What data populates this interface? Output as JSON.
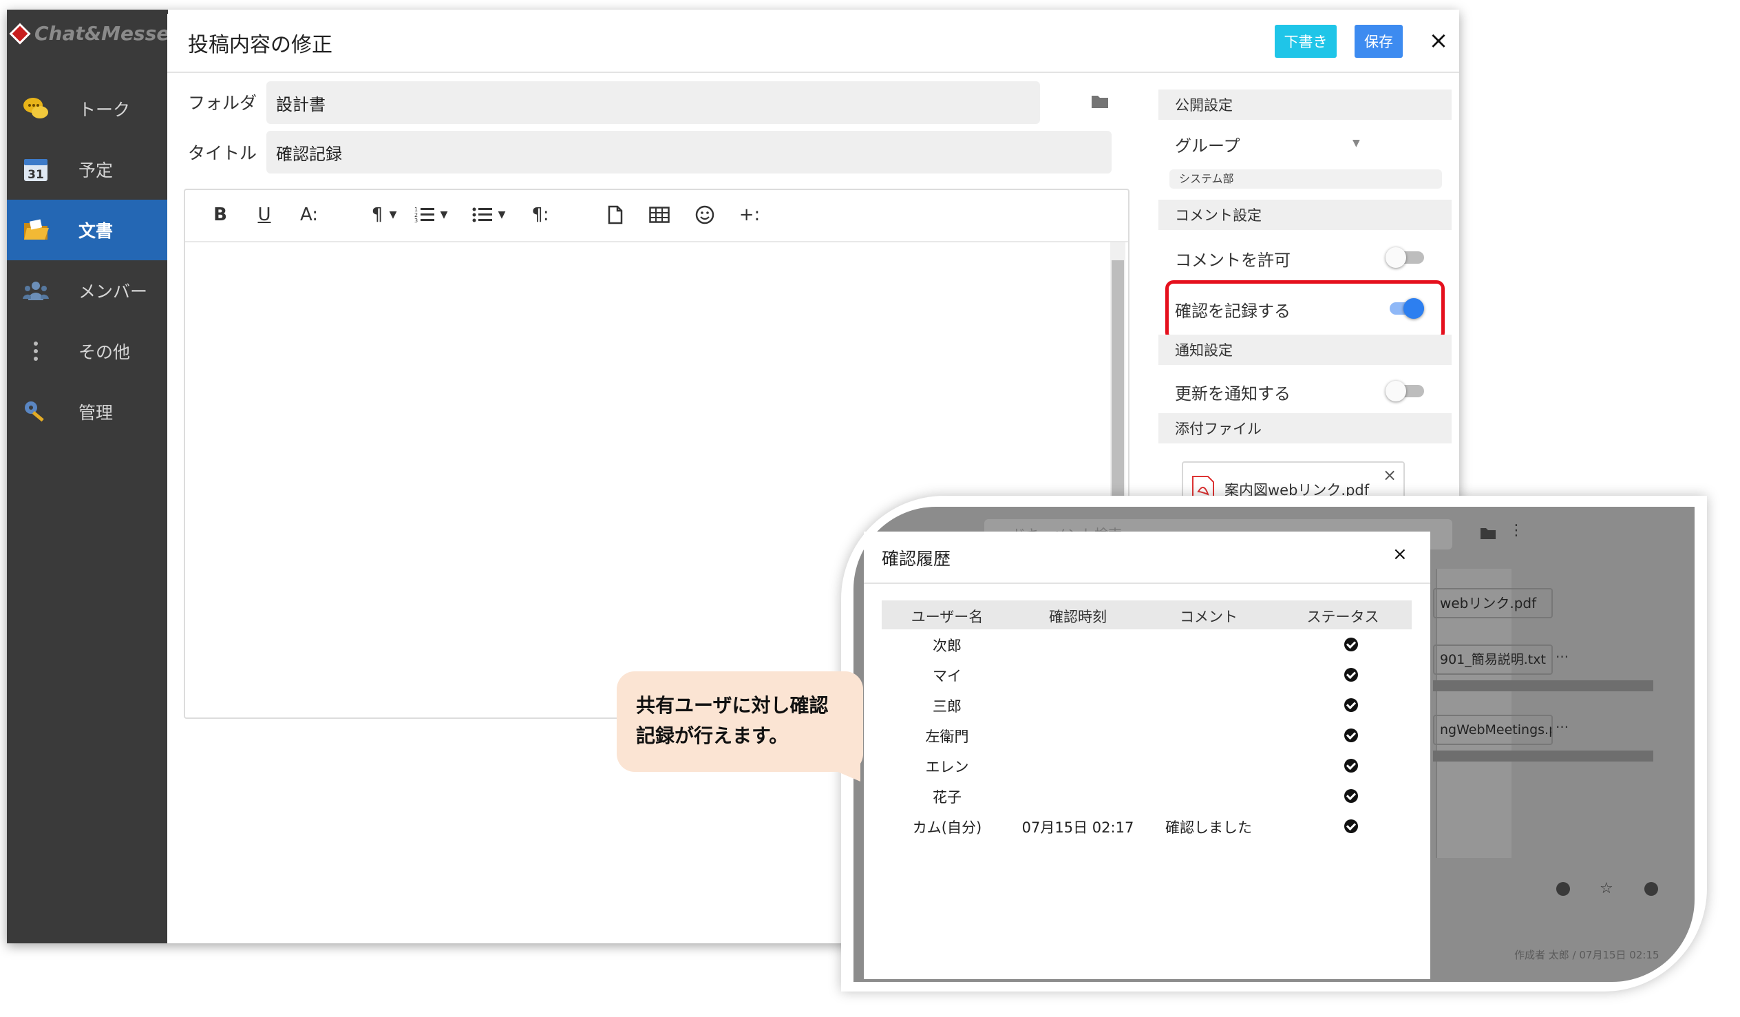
{
  "app": {
    "logo_text": "Chat&Messen"
  },
  "sidebar": {
    "items": [
      {
        "label": "トーク",
        "icon": "chat-icon"
      },
      {
        "label": "予定",
        "icon": "calendar-icon",
        "badge": "31"
      },
      {
        "label": "文書",
        "icon": "folder-open-icon"
      },
      {
        "label": "メンバー",
        "icon": "members-icon"
      },
      {
        "label": "その他",
        "icon": "more-vertical-icon"
      },
      {
        "label": "管理",
        "icon": "key-icon"
      }
    ]
  },
  "modal": {
    "title": "投稿内容の修正",
    "draft_label": "下書き",
    "save_label": "保存",
    "close_label": "×",
    "folder_label": "フォルダ",
    "folder_value": "設計書",
    "title_label": "タイトル",
    "title_value": "確認記録",
    "toolbar": {
      "bold": "B",
      "underline": "U",
      "font_size": "A:",
      "paragraph": "¶",
      "ordered_list": "⋮≡",
      "bullet_list": "≡",
      "para_format": "¶:",
      "insert_more": "+:"
    }
  },
  "settings": {
    "public_head": "公開設定",
    "group_select": "グループ",
    "group_tag": "システム部",
    "comment_head": "コメント設定",
    "allow_comment": "コメントを許可",
    "allow_comment_on": false,
    "record_confirm": "確認を記録する",
    "record_confirm_on": true,
    "notify_head": "通知設定",
    "notify_update": "更新を通知する",
    "notify_update_on": false,
    "attach_head": "添付ファイル",
    "attachment_name": "案内図webリンク.pdf",
    "attachment_type": "PDF"
  },
  "background_panel": {
    "search_placeholder": "ドキュメント検索",
    "files": [
      "webリンク.pdf",
      "901_簡易説明.txt",
      "ngWebMeetings.pptx"
    ],
    "footer": "作成者 太郎 / 07月15日 02:15"
  },
  "dialog": {
    "title": "確認履歴",
    "close_label": "×",
    "columns": [
      "ユーザー名",
      "確認時刻",
      "コメント",
      "ステータス"
    ],
    "rows": [
      {
        "user": "次郎",
        "time": "",
        "comment": "",
        "confirmed": true
      },
      {
        "user": "マイ",
        "time": "",
        "comment": "",
        "confirmed": true
      },
      {
        "user": "三郎",
        "time": "",
        "comment": "",
        "confirmed": true
      },
      {
        "user": "左衛門",
        "time": "",
        "comment": "",
        "confirmed": true
      },
      {
        "user": "エレン",
        "time": "",
        "comment": "",
        "confirmed": true
      },
      {
        "user": "花子",
        "time": "",
        "comment": "",
        "confirmed": true
      },
      {
        "user": "カム(自分)",
        "time": "07月15日 02:17",
        "comment": "確認しました",
        "confirmed": true
      }
    ]
  },
  "callout": {
    "line1": "共有ユーザに対し確認",
    "line2": "記録が行えます。"
  },
  "colors": {
    "sidebar_bg": "#3a3a3a",
    "sidebar_active": "#2467b4",
    "draft_button": "#1fc5e8",
    "save_button": "#3d8bf0",
    "highlight": "#e5101d",
    "callout_bg": "#fbe4d3",
    "toggle_on": "#2d7ff0"
  }
}
